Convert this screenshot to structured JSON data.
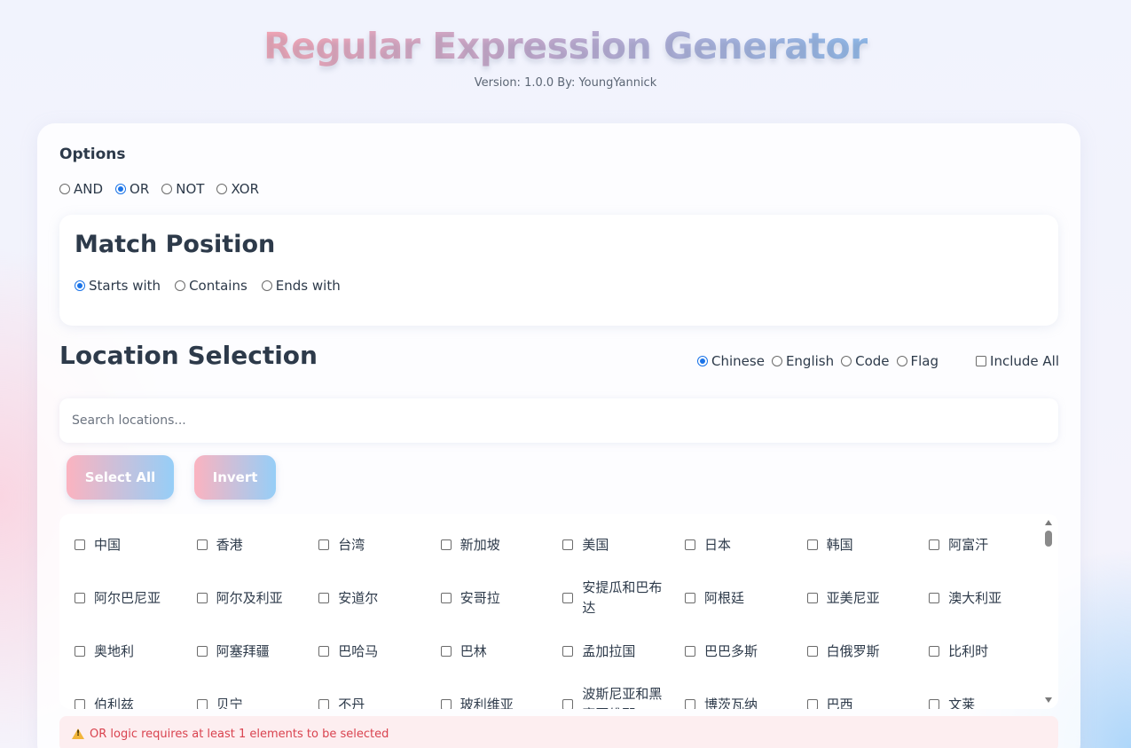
{
  "header": {
    "title": "Regular Expression Generator",
    "version": "Version: 1.0.0 By: YoungYannick"
  },
  "options": {
    "title": "Options",
    "logic": [
      {
        "label": "AND",
        "checked": false
      },
      {
        "label": "OR",
        "checked": true
      },
      {
        "label": "NOT",
        "checked": false
      },
      {
        "label": "XOR",
        "checked": false
      }
    ]
  },
  "match_position": {
    "title": "Match Position",
    "options": [
      {
        "label": "Starts with",
        "checked": true
      },
      {
        "label": "Contains",
        "checked": false
      },
      {
        "label": "Ends with",
        "checked": false
      }
    ]
  },
  "location_selection": {
    "title": "Location Selection",
    "display_modes": [
      {
        "label": "Chinese",
        "checked": true
      },
      {
        "label": "English",
        "checked": false
      },
      {
        "label": "Code",
        "checked": false
      },
      {
        "label": "Flag",
        "checked": false
      }
    ],
    "include_all_label": "Include All",
    "search_placeholder": "Search locations...",
    "select_all_label": "Select All",
    "invert_label": "Invert",
    "locations": [
      "中国",
      "香港",
      "台湾",
      "新加坡",
      "美国",
      "日本",
      "韩国",
      "阿富汗",
      "阿尔巴尼亚",
      "阿尔及利亚",
      "安道尔",
      "安哥拉",
      "安提瓜和巴布达",
      "阿根廷",
      "亚美尼亚",
      "澳大利亚",
      "奥地利",
      "阿塞拜疆",
      "巴哈马",
      "巴林",
      "孟加拉国",
      "巴巴多斯",
      "白俄罗斯",
      "比利时",
      "伯利兹",
      "贝宁",
      "不丹",
      "玻利维亚",
      "波斯尼亚和黑塞哥维那",
      "博茨瓦纳",
      "巴西",
      "文莱"
    ]
  },
  "warning": {
    "text": "OR logic requires at least 1 elements to be selected"
  }
}
